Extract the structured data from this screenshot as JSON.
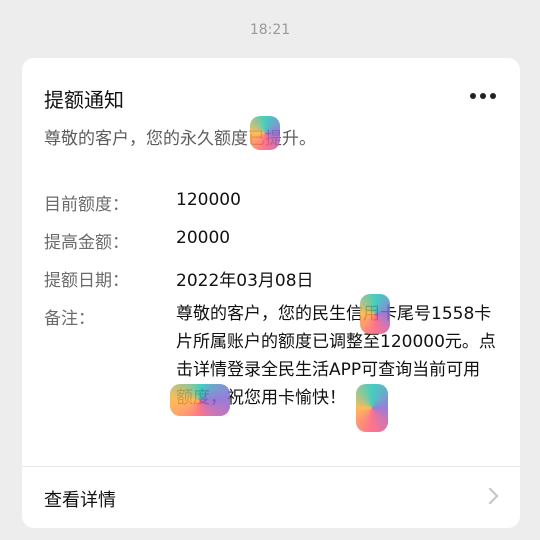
{
  "timestamp": "18:21",
  "card": {
    "title": "提额通知",
    "subtitle": "尊敬的客户，您的永久额度已提升。",
    "fields": [
      {
        "label": "目前额度：",
        "value": "120000"
      },
      {
        "label": "提高金额：",
        "value": "20000"
      },
      {
        "label": "提额日期：",
        "value": "2022年03月08日"
      }
    ],
    "note": {
      "label": "备注：",
      "value": "尊敬的客户，您的民生信用卡尾号1558卡片所属账户的额度已调整至120000元。点击详情登录全民生活APP可查询当前可用额度，祝您用卡愉快！"
    },
    "details_link": "查看详情",
    "more_icon": "more-dots-icon",
    "chevron_icon": "chevron-right-icon"
  }
}
